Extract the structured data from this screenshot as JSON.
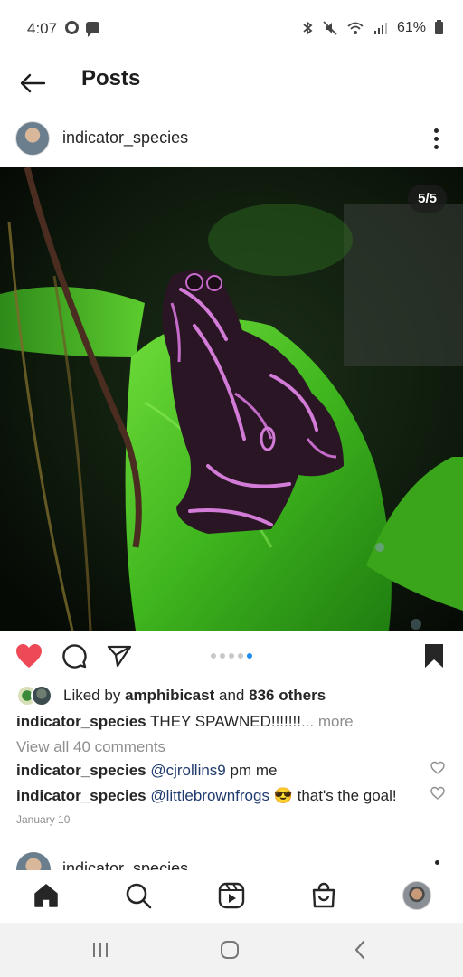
{
  "status_bar": {
    "time": "4:07",
    "battery": "61%"
  },
  "header": {
    "title": "Posts"
  },
  "post": {
    "username": "indicator_species",
    "photo_counter": "5/5",
    "carousel": {
      "total": 5,
      "active_index": 5
    },
    "liked": true,
    "saved": true,
    "likes": {
      "prefix": "Liked by",
      "user": "amphibicast",
      "conjunction": "and",
      "others": "836 others"
    },
    "caption": {
      "username": "indicator_species",
      "text": "THEY SPAWNED!!!!!!!",
      "more": "... more"
    },
    "view_comments": "View all 40 comments",
    "comments": [
      {
        "username": "indicator_species",
        "mention": "@cjrollins9",
        "text": "pm me"
      },
      {
        "username": "indicator_species",
        "mention": "@littlebrownfrogs",
        "emoji": "😎",
        "text": "that's the goal!"
      }
    ],
    "date": "January 10"
  },
  "next_post": {
    "username": "indicator_species"
  },
  "colors": {
    "like_red": "#ed4956",
    "link_blue": "#1f3b6e",
    "active_dot": "#1d8cf5"
  },
  "bottom_nav": [
    "home-icon",
    "search-icon",
    "reels-icon",
    "shop-icon",
    "profile-avatar"
  ],
  "system_nav": [
    "recents-icon",
    "home-circle-icon",
    "back-chevron-icon"
  ]
}
